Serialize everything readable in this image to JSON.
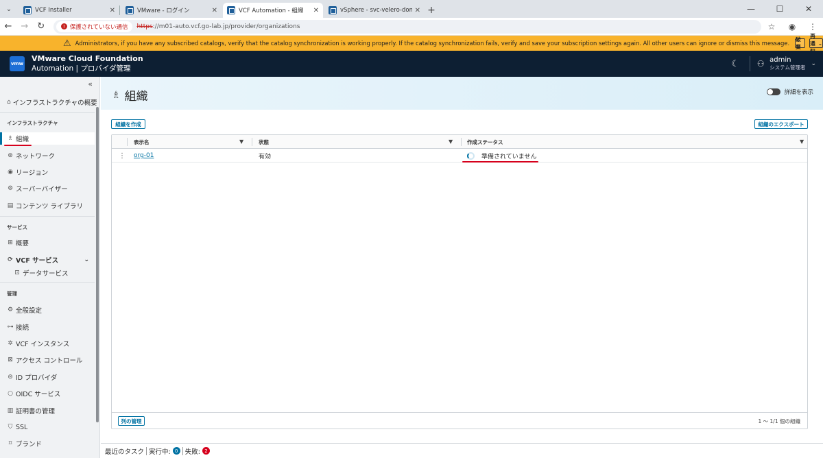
{
  "browser": {
    "tabs": [
      {
        "title": "VCF Installer",
        "active": false
      },
      {
        "title": "VMware - ログイン",
        "active": false
      },
      {
        "title": "VCF Automation - 組織",
        "active": true
      },
      {
        "title": "vSphere - svc-velero-domain-c",
        "active": false
      }
    ],
    "security_label": "保護されていない通信",
    "url_scheme": "https",
    "url_rest": "://m01-auto.vcf.go-lab.jp/provider/organizations"
  },
  "banner": {
    "message": "Administrators, if you have any subscribed catalogs, verify that the catalog synchronization is working properly. If the catalog synchronization fails, verify and save your subscription settings again. All other users can ignore or dismiss this message.",
    "discard_label": "破棄",
    "remind_label": "再通知"
  },
  "header": {
    "logo": "vmw",
    "brand_line1": "VMware Cloud Foundation",
    "brand_line2": "Automation | プロバイダ管理",
    "user_name": "admin",
    "user_role": "システム管理者"
  },
  "sidebar": {
    "overview_infra": "インフラストラクチャの概要",
    "section_infra": "インフラストラクチャ",
    "organizations": "組織",
    "network": "ネットワーク",
    "region": "リージョン",
    "supervisor": "スーパーバイザー",
    "content_library": "コンテンツ ライブラリ",
    "section_services": "サービス",
    "summary": "概要",
    "vcf_services": "VCF サービス",
    "data_services": "データサービス",
    "section_admin": "管理",
    "general_settings": "全般設定",
    "connections": "接続",
    "vcf_instances": "VCF インスタンス",
    "access_control": "アクセス コントロール",
    "id_provider": "ID プロバイダ",
    "oidc_service": "OIDC サービス",
    "cert_management": "証明書の管理",
    "ssl": "SSL",
    "brand": "ブランド"
  },
  "page": {
    "title": "組織",
    "show_details": "詳細を表示",
    "create_button": "組織を作成",
    "export_button": "組織のエクスポート",
    "columns": [
      "表示名",
      "状態",
      "作成ステータス"
    ],
    "rows": [
      {
        "name": "org-01",
        "state": "有効",
        "creation_status": "準備されていません"
      }
    ],
    "manage_columns": "列の管理",
    "footer_count": "1 ～ 1/1 個の組織"
  },
  "taskbar": {
    "title": "最近のタスク",
    "running_label": "実行中:",
    "running_count": "0",
    "failed_label": "失敗:",
    "failed_count": "2"
  }
}
